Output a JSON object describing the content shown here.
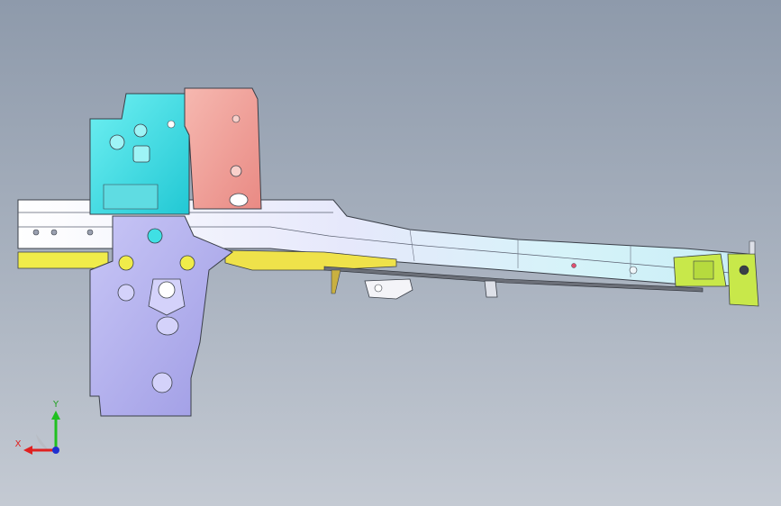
{
  "viewport": {
    "background_top": "#8e9aab",
    "background_bottom": "#c4cad3"
  },
  "model": {
    "colors": {
      "cyan_part": "#3fe0e4",
      "salmon_part": "#f2a29a",
      "lavender_part": "#b8b6f0",
      "yellow_part": "#f0ec4a",
      "white_rail": "#f4f6fa",
      "light_cyan_rail": "#d8f2f8",
      "green_bracket": "#c8e84a",
      "edge": "#3a3f48"
    }
  },
  "triad": {
    "x_label": "X",
    "y_label": "Y",
    "x_color": "#e02020",
    "y_color": "#20c020",
    "z_color": "#2030d0"
  }
}
